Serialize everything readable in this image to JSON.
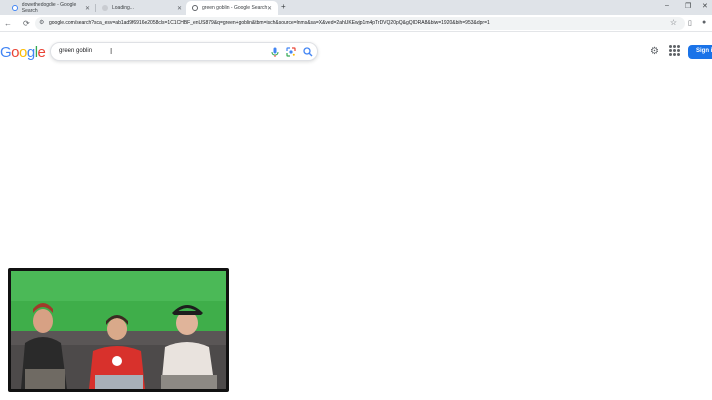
{
  "browser": {
    "tabs": [
      {
        "label": "dowethedogdie - Google Search",
        "favicon": "google-favicon",
        "active": false
      },
      {
        "label": "Loading...",
        "favicon": "loading-favicon",
        "active": false
      },
      {
        "label": "green goblin - Google Search",
        "favicon": "google-favicon",
        "active": true
      }
    ],
    "new_tab": "+",
    "window_controls": {
      "minimize": "–",
      "restore": "❐",
      "close": "✕"
    },
    "url": "google.com/search?sca_esv=ab1ad9f6916e2058cls=1C1CHBF_enUS879&q=green+goblin&tbm=isch&source=lnms&sa=X&ved=2ahUKEwjp1m4pTrDVQ20pQ&gQIDRA8&biw=1920&bih=953&dpr=1"
  },
  "google": {
    "logo_letters": [
      {
        "ch": "G",
        "color": "#4285f4"
      },
      {
        "ch": "o",
        "color": "#ea4335"
      },
      {
        "ch": "o",
        "color": "#fbbc05"
      },
      {
        "ch": "g",
        "color": "#4285f4"
      },
      {
        "ch": "l",
        "color": "#34a853"
      },
      {
        "ch": "e",
        "color": "#ea4335"
      }
    ],
    "query": "green goblin",
    "sign_in_label": "Sign in",
    "accent": "#1a73e8"
  },
  "icons": {
    "mic": "mic-icon",
    "lens": "camera-lens-icon",
    "search": "search-icon",
    "settings": "gear-icon",
    "apps": "apps-grid-icon"
  },
  "video_overlay": {
    "description": "webcam-overlay",
    "background_color": "#3fae4a"
  }
}
